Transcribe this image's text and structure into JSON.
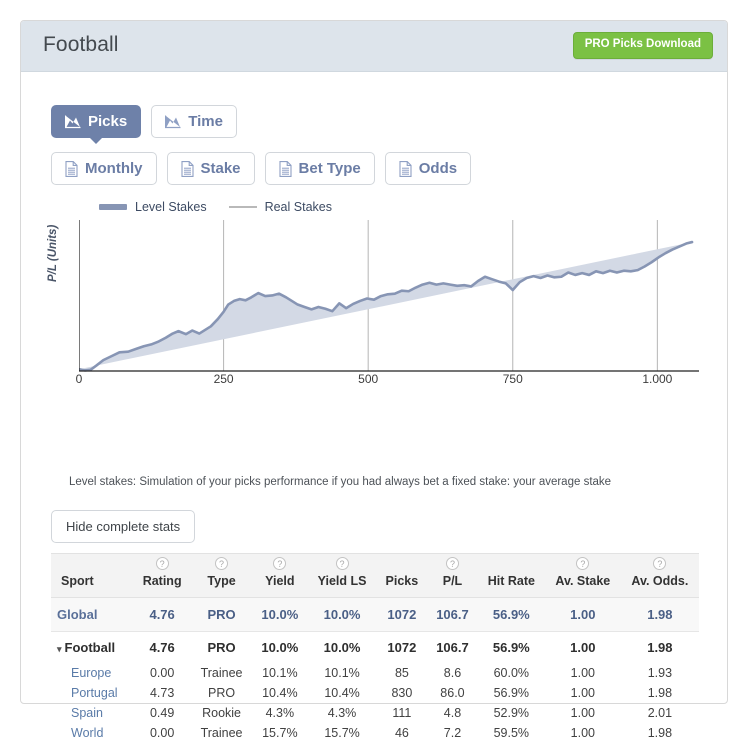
{
  "header": {
    "title": "Football",
    "download_button": "PRO Picks Download"
  },
  "tabs_primary": [
    {
      "label": "Picks",
      "icon": "area-chart-icon",
      "active": true
    },
    {
      "label": "Time",
      "icon": "area-chart-icon",
      "active": false
    }
  ],
  "tabs_secondary": [
    {
      "label": "Monthly",
      "icon": "document-icon"
    },
    {
      "label": "Stake",
      "icon": "document-icon"
    },
    {
      "label": "Bet Type",
      "icon": "document-icon"
    },
    {
      "label": "Odds",
      "icon": "document-icon"
    }
  ],
  "chart_caption": "Level stakes: Simulation of your picks performance if you had always bet a fixed stake: your average stake",
  "hide_stats_button": "Hide complete stats",
  "colors": {
    "accent_blue": "#6e81a9",
    "green": "#7bc144",
    "header_bg": "#dde4eb",
    "series_line": "#8795b4",
    "series_fill": "#d3d9e5",
    "gridline": "#b5b5b5"
  },
  "chart_data": {
    "type": "area",
    "title": "",
    "xlabel": "",
    "ylabel": "P/L (Units)",
    "xlim": [
      0,
      1072
    ],
    "ylim": [
      0,
      120
    ],
    "grid": "vertical-only",
    "legend_position": "top-left",
    "xticks": [
      0,
      250,
      500,
      750,
      1000
    ],
    "xticklabels": [
      "0",
      "250",
      "500",
      "750",
      "1.000"
    ],
    "series": [
      {
        "name": "Level Stakes",
        "color": "#8795b4",
        "fill": "#d3d9e5",
        "x": [
          0,
          10,
          20,
          30,
          42,
          55,
          70,
          85,
          100,
          112,
          125,
          138,
          150,
          162,
          172,
          185,
          196,
          208,
          218,
          228,
          240,
          250,
          258,
          268,
          278,
          288,
          298,
          310,
          322,
          334,
          346,
          358,
          368,
          378,
          390,
          402,
          414,
          426,
          438,
          450,
          462,
          474,
          486,
          498,
          510,
          522,
          534,
          546,
          558,
          570,
          582,
          594,
          606,
          618,
          630,
          642,
          654,
          666,
          678,
          690,
          702,
          714,
          726,
          738,
          750,
          762,
          774,
          786,
          798,
          810,
          822,
          834,
          846,
          858,
          870,
          882,
          894,
          906,
          918,
          930,
          942,
          954,
          966,
          978,
          990,
          1002,
          1014,
          1026,
          1038,
          1050,
          1060,
          1072
        ],
        "y": [
          1.5,
          0.5,
          1.0,
          4.5,
          9.0,
          12.0,
          15.5,
          16.0,
          18.5,
          20.5,
          22.0,
          24.5,
          27.5,
          31.0,
          33.0,
          30.5,
          33.5,
          31.0,
          34.0,
          37.0,
          43.0,
          49.0,
          55.0,
          58.0,
          59.5,
          58.5,
          61.0,
          64.5,
          62.0,
          62.5,
          64.0,
          61.0,
          58.0,
          55.0,
          53.0,
          51.0,
          53.0,
          51.5,
          49.5,
          56.0,
          52.0,
          55.5,
          58.0,
          60.0,
          59.0,
          62.0,
          63.5,
          64.0,
          66.5,
          66.0,
          69.0,
          71.5,
          73.0,
          71.5,
          72.5,
          71.5,
          70.5,
          71.0,
          70.0,
          74.5,
          78.0,
          76.0,
          74.0,
          72.5,
          67.0,
          73.5,
          77.0,
          78.5,
          77.0,
          79.0,
          77.5,
          78.0,
          81.5,
          79.5,
          81.0,
          79.5,
          82.5,
          81.0,
          83.0,
          81.5,
          83.0,
          82.5,
          83.5,
          86.5,
          90.0,
          94.0,
          97.5,
          100.5,
          103.0,
          105.5,
          106.7
        ]
      },
      {
        "name": "Real Stakes",
        "color": "#b9b9b9",
        "visible": false,
        "x": [],
        "y": []
      }
    ]
  },
  "table": {
    "columns": [
      {
        "key": "sport",
        "label": "Sport",
        "help": false
      },
      {
        "key": "rating",
        "label": "Rating",
        "help": true
      },
      {
        "key": "type",
        "label": "Type",
        "help": true
      },
      {
        "key": "yield",
        "label": "Yield",
        "help": true
      },
      {
        "key": "yield_ls",
        "label": "Yield LS",
        "help": true
      },
      {
        "key": "picks",
        "label": "Picks",
        "help": false
      },
      {
        "key": "pl",
        "label": "P/L",
        "help": true
      },
      {
        "key": "hit_rate",
        "label": "Hit Rate",
        "help": false
      },
      {
        "key": "av_stake",
        "label": "Av. Stake",
        "help": true
      },
      {
        "key": "av_odds",
        "label": "Av. Odds.",
        "help": true
      }
    ],
    "help_glyph": "?",
    "caret_glyph": "▾",
    "rows": [
      {
        "kind": "global",
        "sport": "Global",
        "rating": "4.76",
        "type": "PRO",
        "yield": "10.0%",
        "yield_ls": "10.0%",
        "picks": "1072",
        "pl": "106.7",
        "hit_rate": "56.9%",
        "av_stake": "1.00",
        "av_odds": "1.98"
      },
      {
        "kind": "group",
        "sport": "Football",
        "rating": "4.76",
        "type": "PRO",
        "yield": "10.0%",
        "yield_ls": "10.0%",
        "picks": "1072",
        "pl": "106.7",
        "hit_rate": "56.9%",
        "av_stake": "1.00",
        "av_odds": "1.98"
      },
      {
        "kind": "child",
        "sport": "Europe",
        "rating": "0.00",
        "type": "Trainee",
        "yield": "10.1%",
        "yield_ls": "10.1%",
        "picks": "85",
        "pl": "8.6",
        "hit_rate": "60.0%",
        "av_stake": "1.00",
        "av_odds": "1.93"
      },
      {
        "kind": "child",
        "sport": "Portugal",
        "rating": "4.73",
        "type": "PRO",
        "yield": "10.4%",
        "yield_ls": "10.4%",
        "picks": "830",
        "pl": "86.0",
        "hit_rate": "56.9%",
        "av_stake": "1.00",
        "av_odds": "1.98"
      },
      {
        "kind": "child",
        "sport": "Spain",
        "rating": "0.49",
        "type": "Rookie",
        "yield": "4.3%",
        "yield_ls": "4.3%",
        "picks": "111",
        "pl": "4.8",
        "hit_rate": "52.9%",
        "av_stake": "1.00",
        "av_odds": "2.01"
      },
      {
        "kind": "child",
        "sport": "World",
        "rating": "0.00",
        "type": "Trainee",
        "yield": "15.7%",
        "yield_ls": "15.7%",
        "picks": "46",
        "pl": "7.2",
        "hit_rate": "59.5%",
        "av_stake": "1.00",
        "av_odds": "1.98"
      }
    ]
  }
}
